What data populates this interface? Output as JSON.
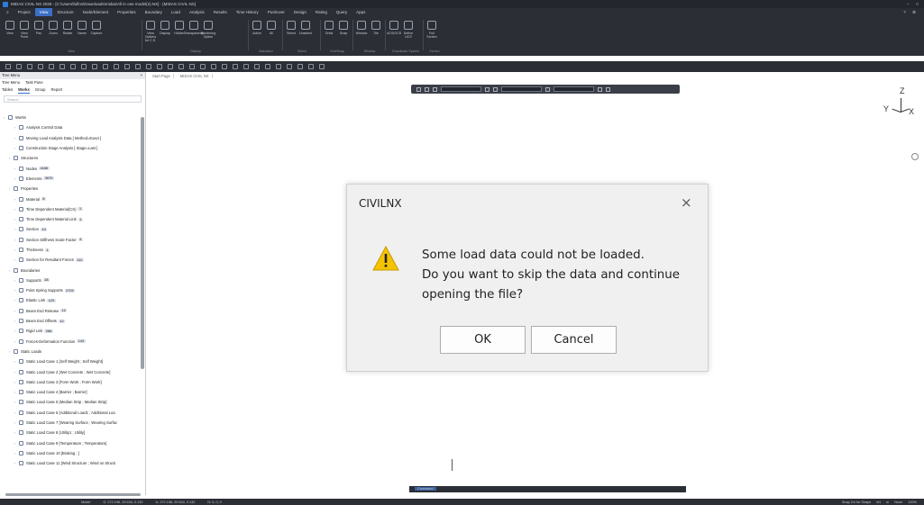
{
  "window": {
    "title": "MIDAS CIVIL NX 2026 - [C:\\Users\\fulfos\\Downloads\\midas\\All in one model(2).NX] - [MIDAS CIVIL NX]"
  },
  "menu": {
    "items": [
      "Project",
      "View",
      "Structure",
      "Node/Element",
      "Properties",
      "Boundary",
      "Load",
      "Analysis",
      "Results",
      "Time History",
      "Pushover",
      "Design",
      "Rating",
      "Query",
      "Apps"
    ],
    "active": "View"
  },
  "ribbon": {
    "groups": [
      {
        "label": "View",
        "buttons": [
          "View",
          "View Point",
          "Pan",
          "Zoom",
          "Rotate",
          "Name",
          "Capture"
        ]
      },
      {
        "label": "Display",
        "buttons": [
          "View Options for C.S.",
          "Display",
          "Hidden",
          "Transparency",
          "Rendering Option"
        ]
      },
      {
        "label": "Activation",
        "buttons": [
          "Active",
          "All"
        ]
      },
      {
        "label": "Select",
        "buttons": [
          "Select",
          "Unselect"
        ]
      },
      {
        "label": "Grid/Snap",
        "buttons": [
          "Grids",
          "Snap"
        ]
      },
      {
        "label": "Window",
        "buttons": [
          "Window",
          "Tile"
        ]
      },
      {
        "label": "Coordinate System",
        "buttons": [
          "UCS/GCS",
          "Define UCS"
        ]
      },
      {
        "label": "Screen",
        "buttons": [
          "Full Screen"
        ]
      }
    ]
  },
  "panel": {
    "title": "Tree Menu",
    "tabs": [
      "Tree Menu",
      "Task Pane"
    ],
    "subtabs": [
      "Tables",
      "Works",
      "Group",
      "Report"
    ],
    "active_subtab": "Works",
    "search_placeholder": "Search",
    "tree": [
      {
        "label": "Works",
        "count": ""
      },
      {
        "label": "Analysis Control Data",
        "count": ""
      },
      {
        "label": "Moving Load Analysis Data [ Method=Exact ]",
        "count": ""
      },
      {
        "label": "Construction Stage Analysis [ Stage=Last ]",
        "count": ""
      },
      {
        "label": "Structures",
        "count": ""
      },
      {
        "label": "Nodes",
        "count": "4166"
      },
      {
        "label": "Elements",
        "count": "3670"
      },
      {
        "label": "Properties",
        "count": ""
      },
      {
        "label": "Material",
        "count": "8"
      },
      {
        "label": "Time Dependent Material(CS)",
        "count": "1"
      },
      {
        "label": "Time Dependent Material Link",
        "count": "1"
      },
      {
        "label": "Section",
        "count": "13"
      },
      {
        "label": "Section Stiffness Scale Factor",
        "count": "4"
      },
      {
        "label": "Thickness",
        "count": "1"
      },
      {
        "label": "Section for Resultant Forces",
        "count": "112"
      },
      {
        "label": "Boundaries",
        "count": ""
      },
      {
        "label": "Supports",
        "count": "18"
      },
      {
        "label": "Point Spring Supports",
        "count": "2702"
      },
      {
        "label": "Elastic Link",
        "count": "123"
      },
      {
        "label": "Beam End Release",
        "count": "12"
      },
      {
        "label": "Beam End Offsets",
        "count": "12"
      },
      {
        "label": "Rigid Link",
        "count": "286"
      },
      {
        "label": "Forces-Deformation Function",
        "count": "143"
      },
      {
        "label": "Static Loads",
        "count": ""
      },
      {
        "label": "Static Load Case 1 [Self Weight ; Self Weight]",
        "count": ""
      },
      {
        "label": "Static Load Case 2 [Wet Concrete ; Wet Concrete]",
        "count": ""
      },
      {
        "label": "Static Load Case 3 [Form Work ; Form Work]",
        "count": ""
      },
      {
        "label": "Static Load Case 4 [Barrier ; Barrier]",
        "count": ""
      },
      {
        "label": "Static Load Case 5 [Median Strip ; Median Strip]",
        "count": ""
      },
      {
        "label": "Static Load Case 6 [Additional Load1 ; Additional Loa",
        "count": ""
      },
      {
        "label": "Static Load Case 7 [Wearing Surface ; Wearing Surfac",
        "count": ""
      },
      {
        "label": "Static Load Case 8 [Utility1 ; Utility]",
        "count": ""
      },
      {
        "label": "Static Load Case 9 [Temperature ; Temperature]",
        "count": ""
      },
      {
        "label": "Static Load Case 10 [Braking ; ]",
        "count": ""
      },
      {
        "label": "Static Load Case 11 [Wind Structure ; Wind on Structi",
        "count": ""
      }
    ]
  },
  "document": {
    "tabs": [
      "Start Page",
      "MIDAS CIVIL NX"
    ],
    "view_select": "Base"
  },
  "axis": {
    "z": "Z",
    "y": "Y",
    "x": "X"
  },
  "command": {
    "label": "Command"
  },
  "status": {
    "left": "Model",
    "coord1": "G: 272.196, 29.534, 0.132",
    "coord2": "U: 272.196, 29.534, 0.132",
    "ucs": "N: 0, 0, 0",
    "right_items": [
      "Snap On for Shape",
      "kN",
      "m",
      "None",
      "100%"
    ]
  },
  "dialog": {
    "title": "CIVILNX",
    "close": "×",
    "message_lines": [
      "Some load data could not be loaded.",
      "Do you want to skip the data and continue",
      "opening the file?"
    ],
    "ok_label": "OK",
    "cancel_label": "Cancel"
  },
  "colors": {
    "chrome": "#2b2e35",
    "accent": "#3b6fc4",
    "warning": "#f5c400"
  }
}
